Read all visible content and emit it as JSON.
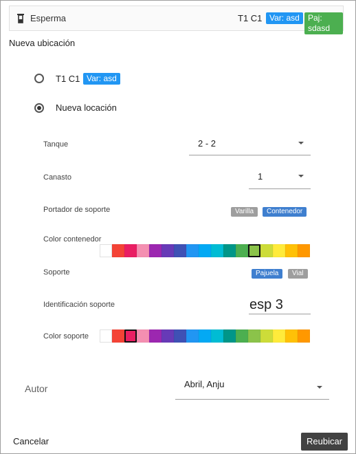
{
  "top": {
    "name": "Esperma",
    "position": "T1 C1",
    "var_chip": "Var: asd",
    "paj_chip": "Paj: sdasd"
  },
  "section_title": "Nueva ubicación",
  "options": [
    {
      "label": "T1 C1",
      "chip": "Var: asd",
      "checked": false
    },
    {
      "label": "Nueva locación",
      "checked": true
    }
  ],
  "form": {
    "tanque": {
      "label": "Tanque",
      "value": "2 - 2"
    },
    "canasto": {
      "label": "Canasto",
      "value": "1"
    },
    "portador": {
      "label": "Portador de soporte",
      "options": [
        "Varilla",
        "Contenedor"
      ],
      "selected": "Contenedor"
    },
    "color_contenedor": {
      "label": "Color contenedor",
      "selected_index": 12
    },
    "soporte": {
      "label": "Soporte",
      "options": [
        "Pajuela",
        "Vial"
      ],
      "selected": "Pajuela"
    },
    "identificacion": {
      "label": "Identificación soporte",
      "value": "esp 3"
    },
    "color_soporte": {
      "label": "Color soporte",
      "selected_index": 2
    }
  },
  "palette": [
    "#ffffff",
    "#f44336",
    "#e91e63",
    "#f48fb1",
    "#9c27b0",
    "#673ab7",
    "#3f51b5",
    "#2196f3",
    "#03a9f4",
    "#00bcd4",
    "#009688",
    "#4caf50",
    "#8bc34a",
    "#cddc39",
    "#ffeb3b",
    "#ffc107",
    "#ff9800"
  ],
  "author": {
    "label": "Autor",
    "value": "Abril, Anju"
  },
  "actions": {
    "cancel": "Cancelar",
    "submit": "Reubicar"
  }
}
